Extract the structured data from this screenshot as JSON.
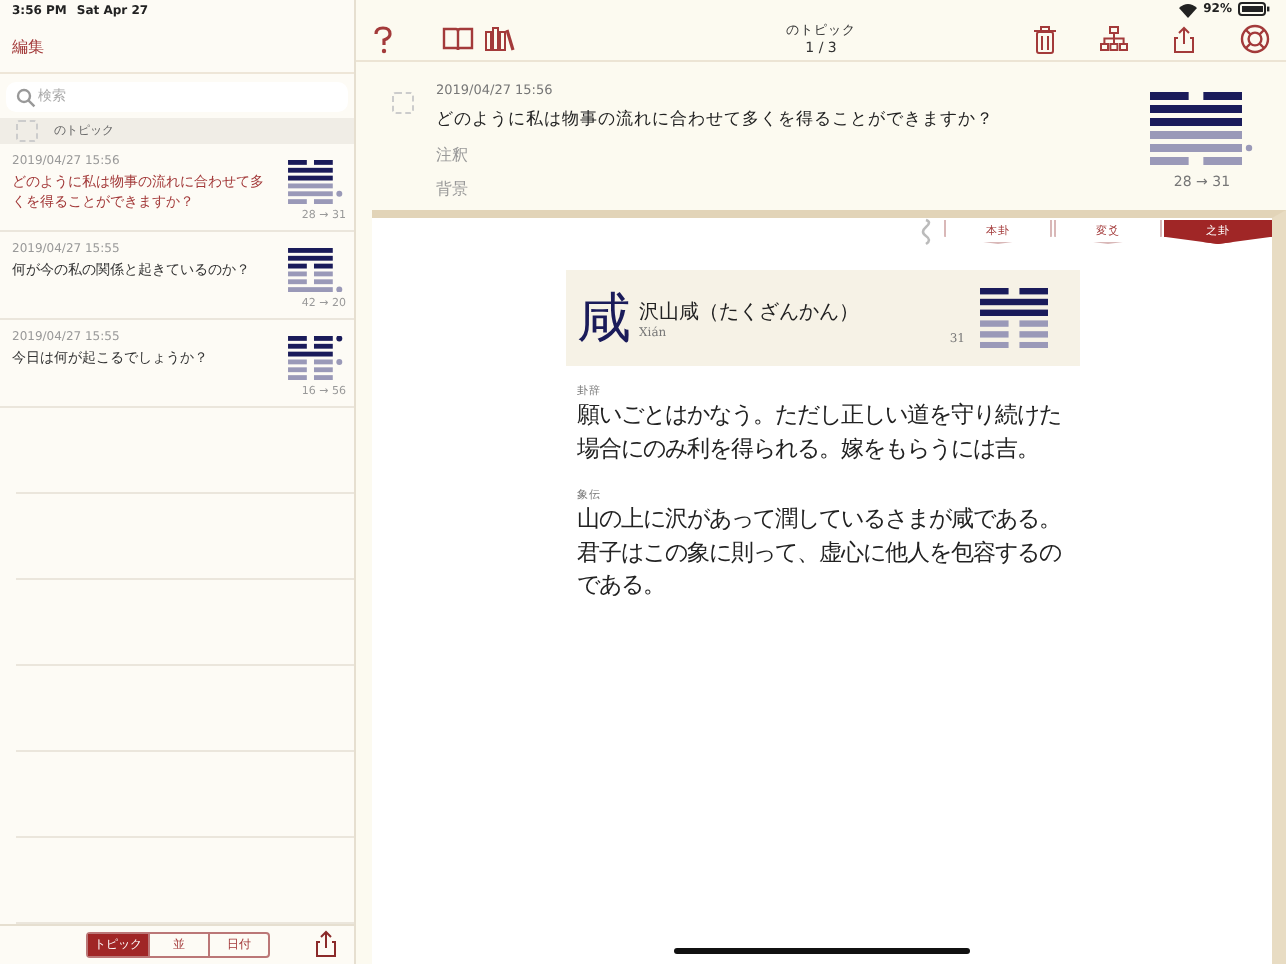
{
  "status_bar": {
    "time": "3:56 PM",
    "date": "Sat Apr 27",
    "battery": "92%"
  },
  "sidebar": {
    "edit_button": "編集",
    "search": {
      "placeholder": "検索"
    },
    "group": {
      "label": "のトピック",
      "checked": false
    },
    "items": [
      {
        "date": "2019/04/27 15:56",
        "question": "どのように私は物事の流れに合わせて多くを得ることができますか？",
        "selected": true,
        "transition": "28 → 31",
        "lines": [
          {
            "kind": "yin",
            "faded": false,
            "changing": false
          },
          {
            "kind": "yang",
            "faded": false,
            "changing": false
          },
          {
            "kind": "yang",
            "faded": false,
            "changing": false
          },
          {
            "kind": "yang",
            "faded": true,
            "changing": false
          },
          {
            "kind": "yang",
            "faded": true,
            "changing": true
          },
          {
            "kind": "yin",
            "faded": true,
            "changing": false
          }
        ]
      },
      {
        "date": "2019/04/27 15:55",
        "question": "何が今の私の関係と起きているのか？",
        "selected": false,
        "transition": "42 → 20",
        "lines": [
          {
            "kind": "yang",
            "faded": false,
            "changing": false
          },
          {
            "kind": "yang",
            "faded": false,
            "changing": false
          },
          {
            "kind": "yin",
            "faded": false,
            "changing": false
          },
          {
            "kind": "yin",
            "faded": true,
            "changing": false
          },
          {
            "kind": "yin",
            "faded": true,
            "changing": false
          },
          {
            "kind": "yang",
            "faded": true,
            "changing": true
          }
        ]
      },
      {
        "date": "2019/04/27 15:55",
        "question": "今日は何が起こるでしょうか？",
        "selected": false,
        "transition": "16 → 56",
        "lines": [
          {
            "kind": "yin",
            "faded": false,
            "changing": true
          },
          {
            "kind": "yin",
            "faded": false,
            "changing": false
          },
          {
            "kind": "yang",
            "faded": false,
            "changing": false
          },
          {
            "kind": "yin",
            "faded": true,
            "changing": true
          },
          {
            "kind": "yin",
            "faded": true,
            "changing": false
          },
          {
            "kind": "yin",
            "faded": true,
            "changing": false
          }
        ]
      }
    ],
    "segments": [
      {
        "label": "トピック",
        "selected": true
      },
      {
        "label": "並",
        "selected": false
      },
      {
        "label": "日付",
        "selected": false
      }
    ]
  },
  "toolbar": {
    "topic": "のトピック",
    "page": "1 / 3"
  },
  "detail": {
    "checked": false,
    "date": "2019/04/27 15:56",
    "question": "どのように私は物事の流れに合わせて多くを得ることができますか？",
    "notes": "注釈",
    "background": "背景",
    "transition": "28 → 31",
    "lines": [
      {
        "kind": "yin",
        "faded": false,
        "changing": false
      },
      {
        "kind": "yang",
        "faded": false,
        "changing": false
      },
      {
        "kind": "yang",
        "faded": false,
        "changing": false
      },
      {
        "kind": "yang",
        "faded": true,
        "changing": false
      },
      {
        "kind": "yang",
        "faded": true,
        "changing": true
      },
      {
        "kind": "yin",
        "faded": true,
        "changing": false
      }
    ]
  },
  "tabs": [
    {
      "label": "本卦",
      "selected": false
    },
    {
      "label": "変爻",
      "selected": false
    },
    {
      "label": "之卦",
      "selected": true
    }
  ],
  "card": {
    "glyph": "咸",
    "name": "沢山咸（たくざんかん）",
    "romaji": "Xián",
    "number": "31",
    "lines": [
      {
        "kind": "yin",
        "faded": false,
        "changing": false
      },
      {
        "kind": "yang",
        "faded": false,
        "changing": false
      },
      {
        "kind": "yang",
        "faded": false,
        "changing": false
      },
      {
        "kind": "yin",
        "faded": true,
        "changing": false
      },
      {
        "kind": "yin",
        "faded": true,
        "changing": false
      },
      {
        "kind": "yin",
        "faded": true,
        "changing": false
      }
    ],
    "sections": [
      {
        "heading": "卦辞",
        "text": "願いごとはかなう。ただし正しい道を守り続けた場合にのみ利を得られる。嫁をもらうには吉。"
      },
      {
        "heading": "象伝",
        "text": "山の上に沢があって潤しているさまが咸である。君子はこの象に則って、虚心に他人を包容するのである。"
      }
    ]
  }
}
